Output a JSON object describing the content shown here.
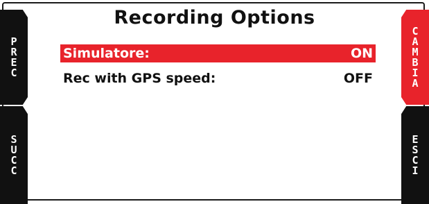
{
  "screen": {
    "title": "Recording Options"
  },
  "options": [
    {
      "label": "Simulatore:",
      "value": "ON",
      "selected": true
    },
    {
      "label": "Rec with GPS speed:",
      "value": "OFF",
      "selected": false
    }
  ],
  "buttons": {
    "prev": "PREC",
    "next": "SUCC",
    "change": "CAMBIA",
    "exit": "ESCI"
  },
  "colors": {
    "highlight": "#e8232b",
    "button_dark": "#111111",
    "button_active": "#e8232b",
    "text": "#111111",
    "background": "#ffffff"
  }
}
